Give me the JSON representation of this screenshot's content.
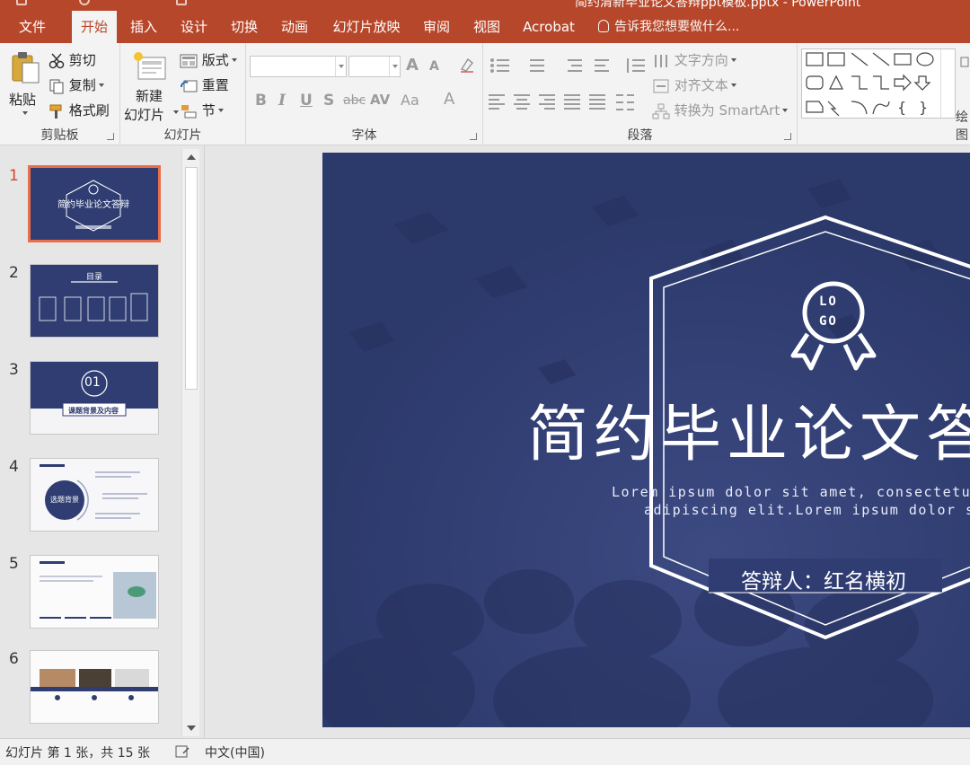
{
  "window": {
    "doc_title": "简约清新毕业论文答辩ppt模板.pptx - PowerPoint"
  },
  "tabs": [
    {
      "label": "文件",
      "active": false
    },
    {
      "label": "开始",
      "active": true
    },
    {
      "label": "插入",
      "active": false
    },
    {
      "label": "设计",
      "active": false
    },
    {
      "label": "切换",
      "active": false
    },
    {
      "label": "动画",
      "active": false
    },
    {
      "label": "幻灯片放映",
      "active": false
    },
    {
      "label": "审阅",
      "active": false
    },
    {
      "label": "视图",
      "active": false
    },
    {
      "label": "Acrobat",
      "active": false
    }
  ],
  "tell_me": "告诉我您想要做什么...",
  "ribbon": {
    "clipboard": {
      "label": "剪贴板",
      "paste": "粘贴",
      "cut": "剪切",
      "copy": "复制",
      "format_painter": "格式刷"
    },
    "slides": {
      "label": "幻灯片",
      "new_slide_line1": "新建",
      "new_slide_line2": "幻灯片",
      "layout": "版式",
      "reset": "重置",
      "section": "节"
    },
    "font": {
      "label": "字体",
      "bold": "B",
      "italic": "I",
      "underline": "U",
      "shadow": "S",
      "strike": "abc",
      "spacing": "AV",
      "case": "Aa",
      "color": "A",
      "grow": "A",
      "shrink": "A"
    },
    "paragraph": {
      "label": "段落",
      "text_direction": "文字方向",
      "align_text": "对齐文本",
      "smartart": "转换为 SmartArt"
    },
    "drawing": {
      "label": "绘图"
    }
  },
  "thumbnails": [
    {
      "num": "1",
      "active": true,
      "title": "简约毕业论文答辩"
    },
    {
      "num": "2",
      "active": false,
      "title": "目录"
    },
    {
      "num": "3",
      "active": false,
      "title": "课题背景及内容",
      "badge": "01"
    },
    {
      "num": "4",
      "active": false,
      "title": "选题背景"
    },
    {
      "num": "5",
      "active": false,
      "title": ""
    },
    {
      "num": "6",
      "active": false,
      "title": ""
    }
  ],
  "slide": {
    "logo_line1": "LO",
    "logo_line2": "GO",
    "title": "简约毕业论文答辩",
    "subtitle_line1": "Lorem ipsum dolor sit amet, consectetuer",
    "subtitle_line2": "adipiscing elit.Lorem ipsum dolor sit",
    "presenter": "答辩人：红名横初",
    "colors": {
      "bg": "#2f3d72",
      "line": "#ffffff"
    }
  },
  "status": {
    "slide_info": "幻灯片 第 1 张，共 15 张",
    "language": "中文(中国)"
  }
}
